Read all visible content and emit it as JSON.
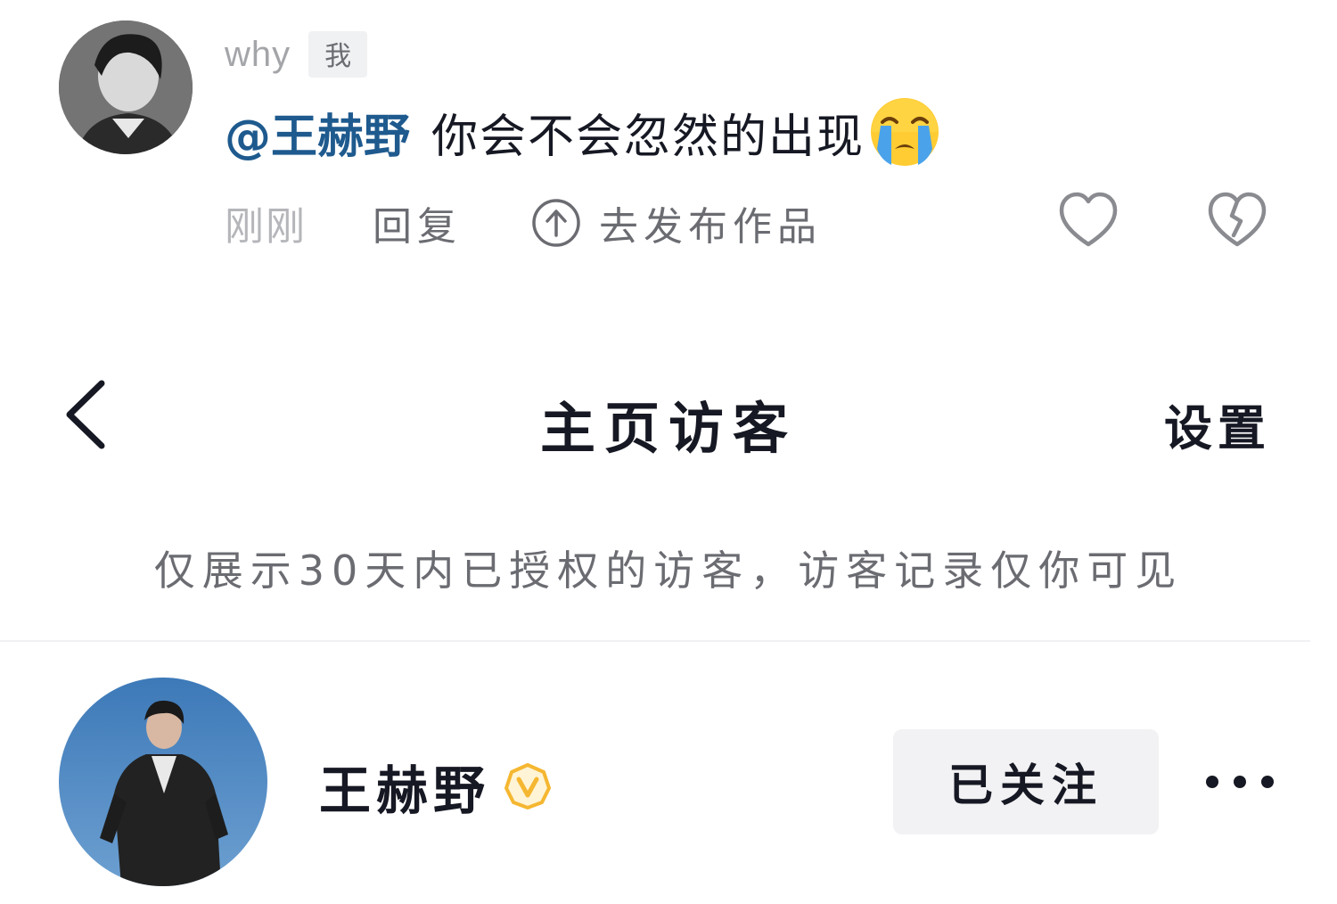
{
  "comment": {
    "username": "why",
    "me_badge": "我",
    "mention": "@王赫野",
    "text": "你会不会忽然的出现",
    "emoji": "loudly-crying-face",
    "time": "刚刚",
    "reply_label": "回复",
    "publish_label": "去发布作品"
  },
  "page": {
    "title": "主页访客",
    "settings_label": "设置",
    "notice": "仅展示30天内已授权的访客，访客记录仅你可见"
  },
  "visitors": [
    {
      "name": "王赫野",
      "verified": true,
      "follow_label": "已关注"
    }
  ],
  "colors": {
    "mention": "#1e5a8e",
    "verified_badge": "#f5b731",
    "follow_button_bg": "#f2f2f4",
    "muted_text": "#6b6c72"
  },
  "icons": [
    "back-arrow-icon",
    "heart-icon",
    "broken-heart-icon",
    "upload-icon",
    "verified-icon",
    "more-icon"
  ]
}
